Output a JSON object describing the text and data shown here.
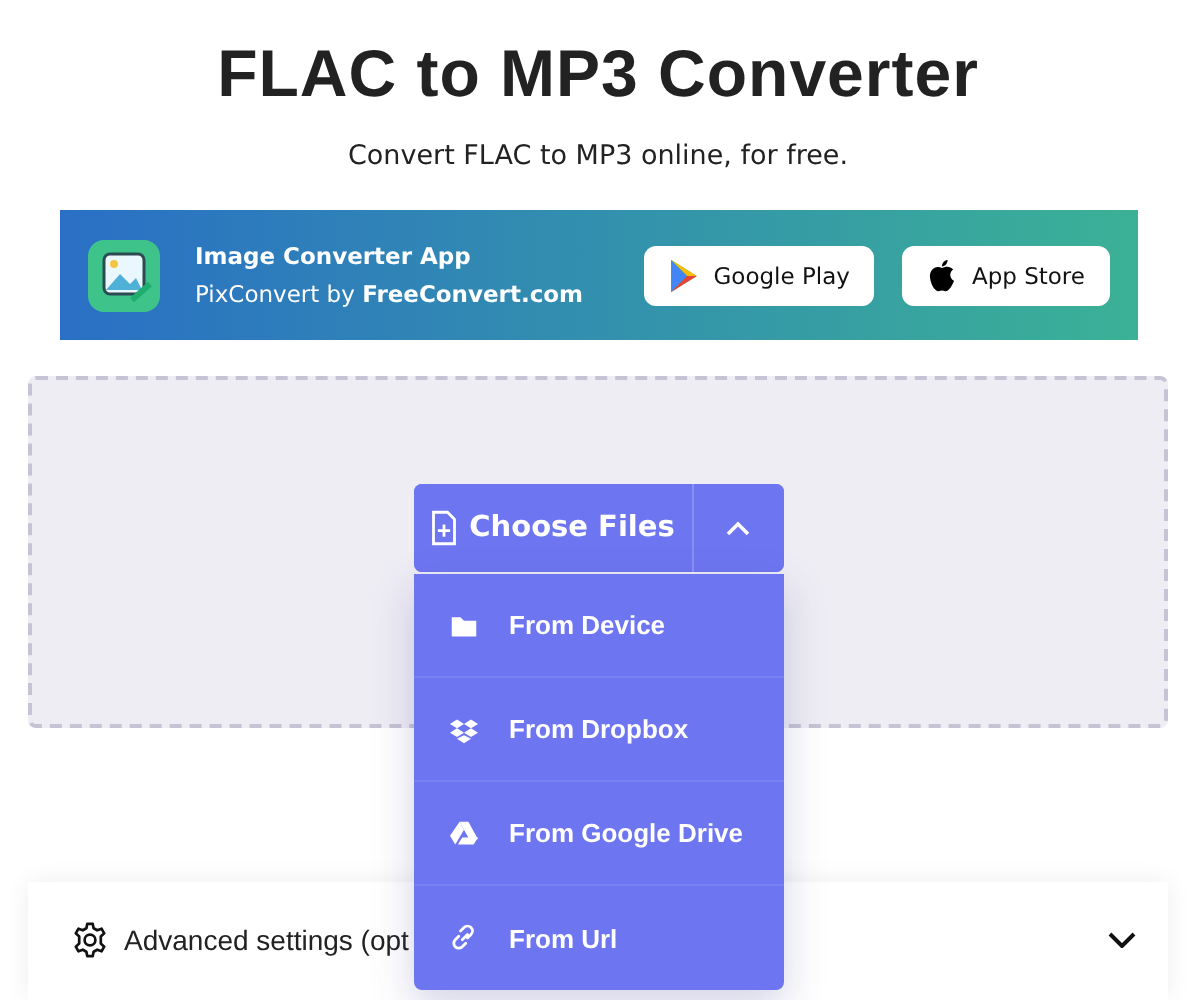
{
  "heading": "FLAC to MP3 Converter",
  "subtitle": "Convert FLAC to MP3 online, for free.",
  "banner": {
    "title": "Image Converter App",
    "byline": "PixConvert by **FreeConvert.com**",
    "stores": [
      {
        "kind": "google",
        "label": "Google Play"
      },
      {
        "kind": "apple",
        "label": "App Store"
      }
    ]
  },
  "upload": {
    "button": "Choose Files",
    "expanded": true,
    "options": [
      {
        "kind": "device",
        "label": "From Device"
      },
      {
        "kind": "dropbox",
        "label": "From Dropbox"
      },
      {
        "kind": "drive",
        "label": "From Google Drive"
      },
      {
        "kind": "url",
        "label": "From Url"
      }
    ]
  },
  "advanced": {
    "label": "Advanced settings (opt",
    "expanded": false
  }
}
